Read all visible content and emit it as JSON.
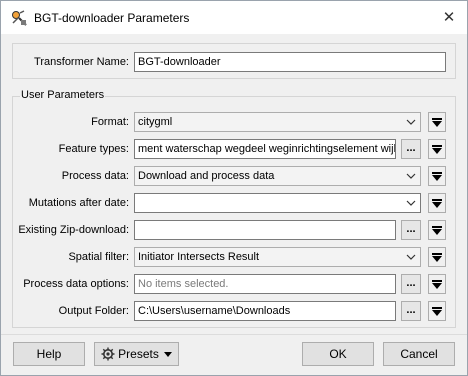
{
  "window": {
    "title": "BGT-downloader Parameters",
    "app_icon": "fme-transformer-icon",
    "close_icon": "close-icon"
  },
  "transformer": {
    "name_label": "Transformer Name:",
    "name_value": "BGT-downloader"
  },
  "user_params": {
    "group_label": "User Parameters",
    "rows": [
      {
        "label": "Format:",
        "value": "citygml",
        "type": "combo"
      },
      {
        "label": "Feature types:",
        "value": "ment waterschap wegdeel weginrichtingselement wijk",
        "type": "text-ellipsis"
      },
      {
        "label": "Process data:",
        "value": "Download and process data",
        "type": "combo"
      },
      {
        "label": "Mutations after date:",
        "value": "",
        "type": "date-combo"
      },
      {
        "label": "Existing Zip-download:",
        "value": "",
        "type": "text-ellipsis"
      },
      {
        "label": "Spatial filter:",
        "value": "Initiator Intersects Result",
        "type": "combo"
      },
      {
        "label": "Process data options:",
        "value": "",
        "placeholder": "No items selected.",
        "type": "text-ellipsis"
      },
      {
        "label": "Output Folder:",
        "value": "C:\\Users\\username\\Downloads",
        "type": "text-ellipsis"
      }
    ],
    "ellipsis_label": "..."
  },
  "buttons": {
    "help": "Help",
    "presets": "Presets",
    "ok": "OK",
    "cancel": "Cancel"
  }
}
